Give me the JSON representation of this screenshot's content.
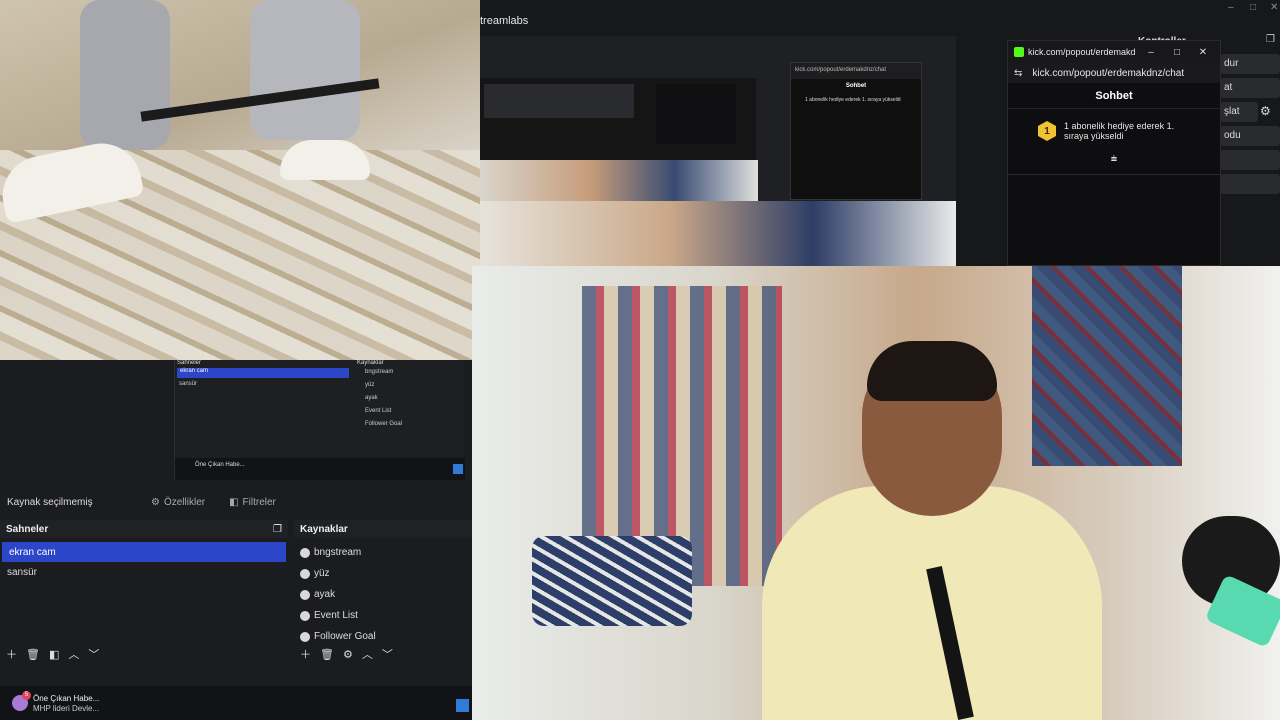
{
  "studio": {
    "title": "treamlabs",
    "window_controls": [
      "–",
      "□",
      "✕"
    ],
    "mini_chat_url": "kick.com/popout/erdemakdnz/chat",
    "mini_chat_header": "Sohbet",
    "mini_chat_message": "1 abonelik hediye ederek 1. sıraya yükseldi"
  },
  "chat_popout": {
    "title": "kick.com/popout/erdemakd...",
    "url": "kick.com/popout/erdemakdnz/chat",
    "header": "Sohbet",
    "rank_badge": "1",
    "message_line1": "1 abonelik hediye ederek 1.",
    "message_line2": "sıraya yükseldi",
    "scroll_icon": "⩧",
    "buttons": {
      "minimize": "–",
      "maximize": "□",
      "close": "✕"
    }
  },
  "controls": {
    "title": "Kontroller",
    "items": [
      "dur",
      "at",
      "şlat",
      "odu"
    ]
  },
  "obs_mini": {
    "scenes_title": "Sahneler",
    "sources_title": "Kaynaklar",
    "scenes": [
      "ekran cam",
      "sansür"
    ],
    "sources": [
      "bngstream",
      "yüz",
      "ayak",
      "Event List",
      "Follower Goal"
    ],
    "news": "Öne Çıkan Habe..."
  },
  "source_toolbar": {
    "no_source": "Kaynak seçilmemiş",
    "properties": "Özellikler",
    "filters": "Filtreler"
  },
  "scenes": {
    "title": "Sahneler",
    "items": [
      "ekran cam",
      "sansür"
    ]
  },
  "sources": {
    "title": "Kaynaklar",
    "items": [
      "bngstream",
      "yüz",
      "ayak",
      "Event List",
      "Follower Goal"
    ]
  },
  "taskbar": {
    "badge": "5",
    "headline": "Öne Çıkan Habe...",
    "subline": "MHP lideri Devle..."
  },
  "icons": [
    "kick-logo",
    "settings-gear-icon",
    "add-icon",
    "remove-icon",
    "filter-icon",
    "arrow-up-icon",
    "arrow-down-icon",
    "windows-start-icon",
    "camera-source-icon"
  ]
}
